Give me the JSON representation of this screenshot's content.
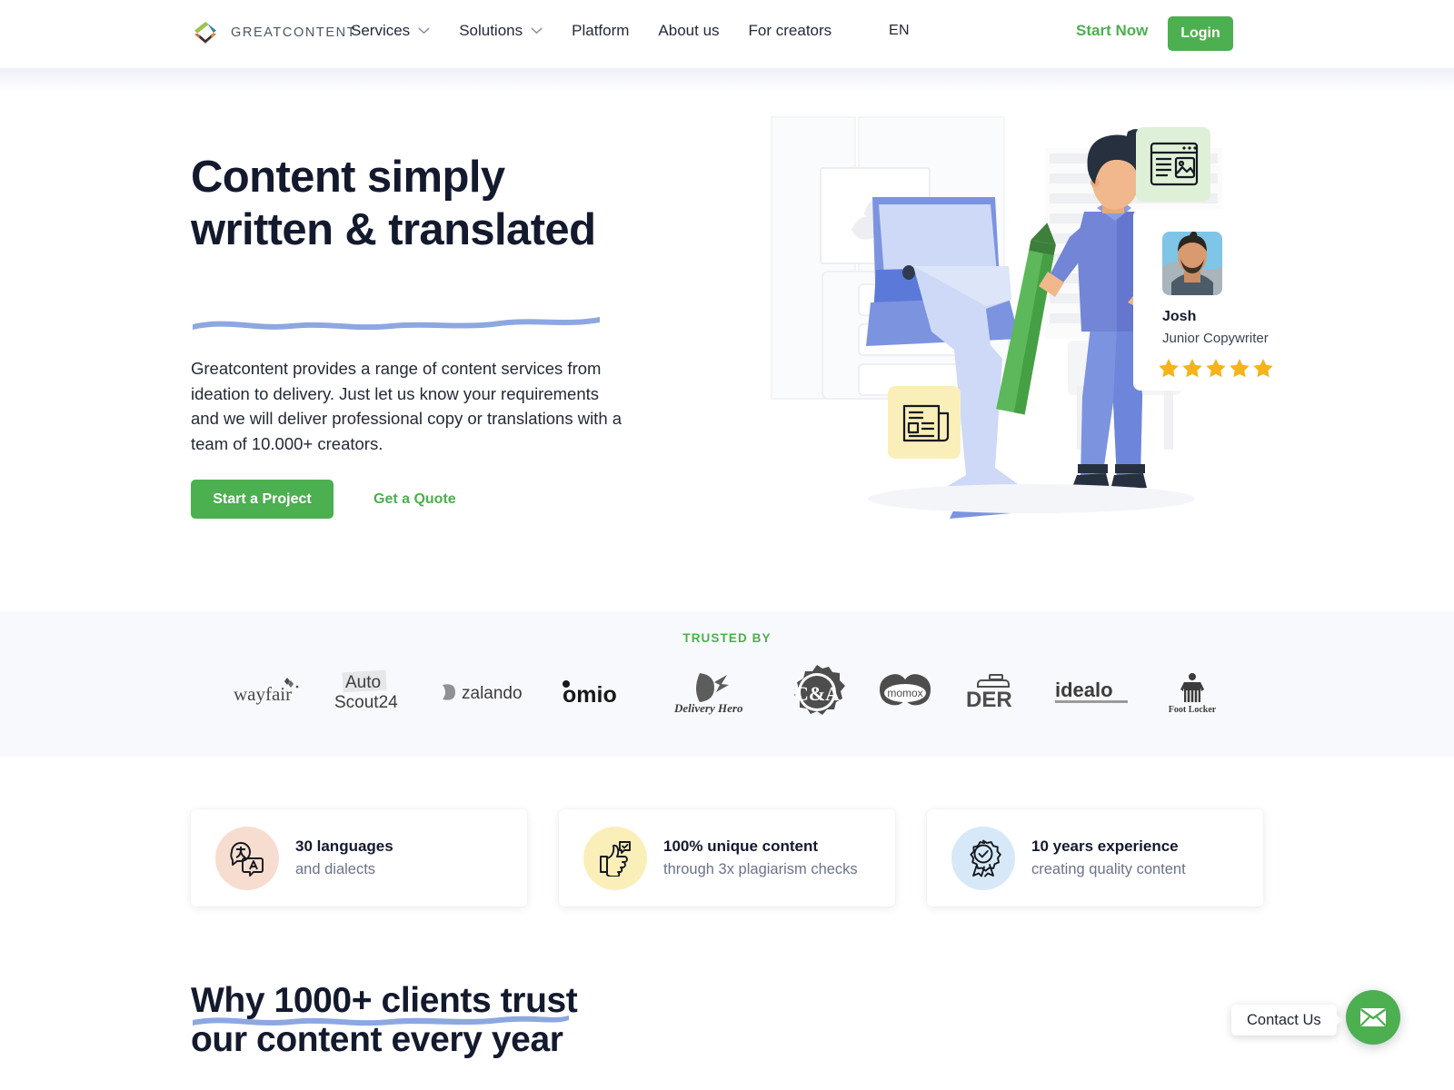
{
  "header": {
    "brand_name": "GREATCONTENT",
    "nav": [
      {
        "label": "Services",
        "has_dropdown": true
      },
      {
        "label": "Solutions",
        "has_dropdown": true
      },
      {
        "label": "Platform",
        "has_dropdown": false
      },
      {
        "label": "About us",
        "has_dropdown": false
      },
      {
        "label": "For creators",
        "has_dropdown": false
      }
    ],
    "language": "EN",
    "start_now_label": "Start Now",
    "login_label": "Login"
  },
  "hero": {
    "title_line1": "Content simply",
    "title_line2": "written & translated",
    "paragraph": "Greatcontent provides a range of content services from ideation to delivery. Just let us know your requirements and we will deliver professional copy or translations with a team of 10.000+ creators.",
    "primary_button": "Start a Project",
    "secondary_button": "Get a Quote",
    "creator_card": {
      "name": "Josh",
      "role": "Junior Copywriter",
      "stars": 5
    }
  },
  "trusted": {
    "label": "TRUSTED BY",
    "logos": [
      "wayfair",
      "AutoScout24",
      "zalando",
      "omio",
      "Delivery Hero",
      "C&A",
      "momox",
      "DER",
      "idealo",
      "Foot Locker"
    ]
  },
  "features": [
    {
      "title": "30 languages",
      "subtitle": "and dialects",
      "icon": "translate-icon",
      "bg": "#f7ddd0"
    },
    {
      "title": "100% unique content",
      "subtitle": "through 3x plagiarism checks",
      "icon": "thumbs-up-check-icon",
      "bg": "#fbefb9"
    },
    {
      "title": "10 years experience",
      "subtitle": "creating quality content",
      "icon": "award-badge-icon",
      "bg": "#d7e9f8"
    }
  ],
  "why": {
    "line1": "Why 1000+ clients trust",
    "line2": "our content every year"
  },
  "contact": {
    "label": "Contact Us",
    "icon": "envelope-icon"
  },
  "colors": {
    "brand_green": "#4caf50",
    "heading_navy": "#141a2e",
    "squiggle_blue": "#8da7e0",
    "band_bg": "#f8f9fc",
    "muted_text": "#6b7389"
  }
}
